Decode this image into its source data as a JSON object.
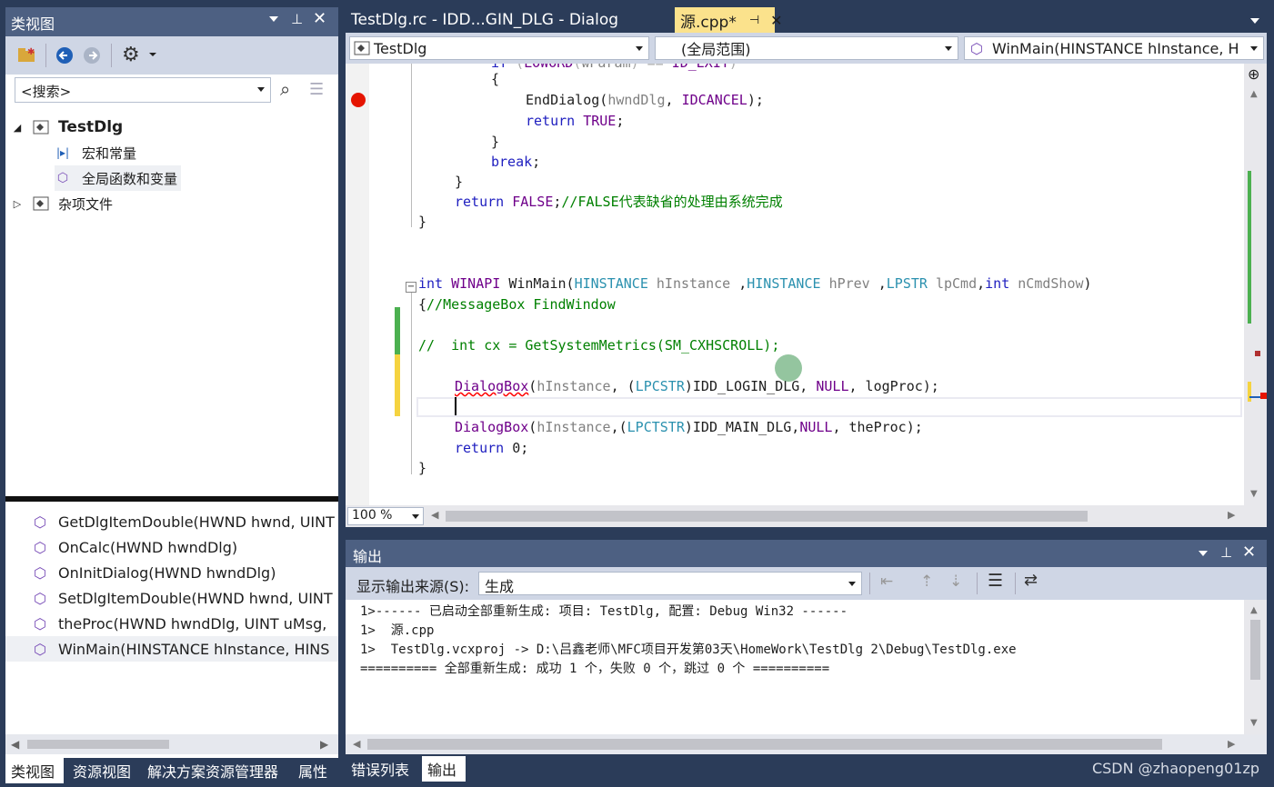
{
  "left_panel": {
    "title": "类视图",
    "search_placeholder": "<搜索>",
    "tree": [
      {
        "label": "TestDlg",
        "bold": true,
        "icon": "project-icon"
      },
      {
        "label": "宏和常量",
        "icon": "macro-icon"
      },
      {
        "label": "全局函数和变量",
        "icon": "global-icon"
      },
      {
        "label": "杂项文件",
        "icon": "folder-icon"
      }
    ],
    "members": [
      "GetDlgItemDouble(HWND hwnd, UINT",
      "OnCalc(HWND hwndDlg)",
      "OnInitDialog(HWND hwndDlg)",
      "SetDlgItemDouble(HWND hwnd, UINT",
      "theProc(HWND hwndDlg, UINT uMsg,",
      "WinMain(HINSTANCE hInstance, HINS"
    ],
    "tabs": [
      "类视图",
      "资源视图",
      "解决方案资源管理器",
      "属性"
    ]
  },
  "editor": {
    "tabs": [
      {
        "label": "TestDlg.rc - IDD...GIN_DLG - Dialog",
        "active": false
      },
      {
        "label": "源.cpp*",
        "active": true
      }
    ],
    "nav": {
      "project": "TestDlg",
      "scope": "(全局范围)",
      "function": "WinMain(HINSTANCE hInstance, H"
    },
    "zoom": "100 %",
    "code_lines": [
      {
        "text": "    if (LOWORD(wParam) == ID_EXIT)",
        "indent": 80
      },
      {
        "text": "{",
        "indent": 134
      },
      {
        "text": "EndDialog(hwndDlg, IDCANCEL);",
        "indent": 172
      },
      {
        "text": "return TRUE;",
        "indent": 172
      },
      {
        "text": "}",
        "indent": 134
      },
      {
        "text": "break;",
        "indent": 134
      },
      {
        "text": "}",
        "indent": 94
      },
      {
        "text": "return FALSE;//FALSE代表缺省的处理由系统完成",
        "indent": 94
      },
      {
        "text": "}",
        "indent": 54
      },
      {
        "text": "",
        "indent": 0
      },
      {
        "text": "",
        "indent": 0
      },
      {
        "text": "int WINAPI WinMain(HINSTANCE hInstance ,HINSTANCE hPrev ,LPSTR lpCmd,int nCmdShow)",
        "indent": 54
      },
      {
        "text": "{//MessageBox FindWindow",
        "indent": 54
      },
      {
        "text": "",
        "indent": 0
      },
      {
        "text": "//  int cx = GetSystemMetrics(SM_CXHSCROLL);",
        "indent": 54
      },
      {
        "text": "",
        "indent": 0
      },
      {
        "text": "DialogBox(hInstance, (LPCSTR)IDD_LOGIN_DLG, NULL, logProc);",
        "indent": 94
      },
      {
        "text": "",
        "indent": 94
      },
      {
        "text": "DialogBox(hInstance,(LPCTSTR)IDD_MAIN_DLG,NULL, theProc);",
        "indent": 94
      },
      {
        "text": "return 0;",
        "indent": 94
      },
      {
        "text": "}",
        "indent": 54
      }
    ]
  },
  "output": {
    "title": "输出",
    "source_label": "显示输出来源(S):",
    "source_value": "生成",
    "lines": [
      "1>------ 已启动全部重新生成: 项目: TestDlg, 配置: Debug Win32 ------",
      "1>  源.cpp",
      "1>  TestDlg.vcxproj -> D:\\吕鑫老师\\MFC项目开发第03天\\HomeWork\\TestDlg 2\\Debug\\TestDlg.exe",
      "========== 全部重新生成: 成功 1 个，失败 0 个，跳过 0 个 =========="
    ],
    "tabs": [
      "错误列表",
      "输出"
    ]
  },
  "watermark": "CSDN @zhaopeng01zp",
  "colors": {
    "chrome": "#2b3c59",
    "panel_title": "#4d6082",
    "active_tab": "#fbe28c",
    "keyword": "#2020c0",
    "type": "#2b91af",
    "comment": "#008000"
  }
}
